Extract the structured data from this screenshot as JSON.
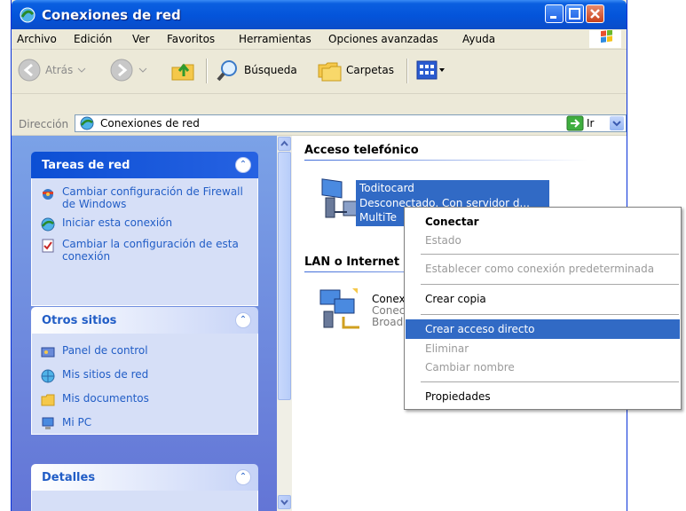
{
  "window": {
    "title": "Conexiones de red"
  },
  "menu": [
    "Archivo",
    "Edición",
    "Ver",
    "Favoritos",
    "Herramientas",
    "Opciones avanzadas",
    "Ayuda"
  ],
  "toolbar": {
    "back_label": "Atrás",
    "search_label": "Búsqueda",
    "folders_label": "Carpetas"
  },
  "address": {
    "label": "Dirección",
    "value": "Conexiones de red",
    "go_label": "Ir"
  },
  "taskpane": {
    "network_tasks": {
      "title": "Tareas de red",
      "items": [
        {
          "label": "Cambiar configuración de Firewall de Windows",
          "icon": "firewall-icon"
        },
        {
          "label": "Iniciar esta conexión",
          "icon": "connect-icon"
        },
        {
          "label": "Cambiar la configuración de esta conexión",
          "icon": "settings-icon"
        }
      ]
    },
    "other_places": {
      "title": "Otros sitios",
      "items": [
        {
          "label": "Panel de control",
          "icon": "control-panel-icon"
        },
        {
          "label": "Mis sitios de red",
          "icon": "network-places-icon"
        },
        {
          "label": "Mis documentos",
          "icon": "documents-folder-icon"
        },
        {
          "label": "Mi PC",
          "icon": "my-computer-icon"
        }
      ]
    },
    "details": {
      "title": "Detalles"
    }
  },
  "content": {
    "dialup": {
      "header": "Acceso telefónico",
      "connection": {
        "name": "Toditocard",
        "status": "Desconectado, Con servidor d...",
        "device": "MultiTe"
      }
    },
    "lan": {
      "header": "LAN o Internet",
      "connection": {
        "name": "Conex",
        "status": "Conec",
        "device": "Broad"
      }
    }
  },
  "context_menu": {
    "items": [
      {
        "label": "Conectar",
        "state": "default"
      },
      {
        "label": "Estado",
        "state": "disabled"
      },
      {
        "label": "Establecer como conexión predeterminada",
        "state": "disabled"
      },
      {
        "label": "Crear copia",
        "state": "enabled"
      },
      {
        "label": "Crear acceso directo",
        "state": "highlighted"
      },
      {
        "label": "Eliminar",
        "state": "disabled"
      },
      {
        "label": "Cambiar nombre",
        "state": "disabled"
      },
      {
        "label": "Propiedades",
        "state": "enabled"
      }
    ]
  },
  "colors": {
    "titlebar": "#0454da",
    "selection": "#316ac5",
    "taskpane_bg": "#6f8ee0",
    "task_link": "#215dc6"
  }
}
